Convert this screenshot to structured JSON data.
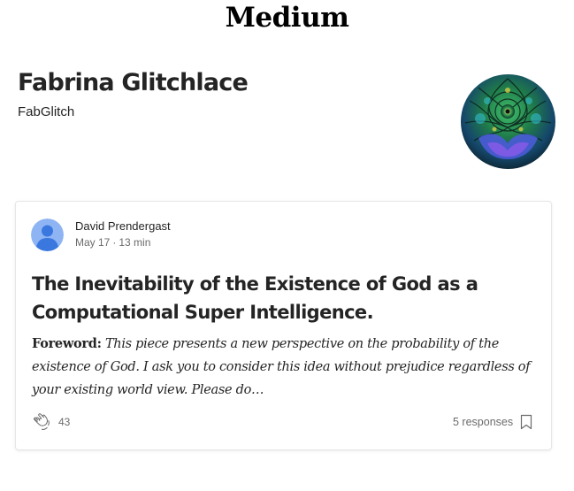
{
  "site": {
    "logo_text": "Medium"
  },
  "profile": {
    "name": "Fabrina Glitchlace",
    "handle": "FabGlitch",
    "avatar_icon": "psychedelic-art-avatar"
  },
  "post": {
    "author": "David Prendergast",
    "author_avatar_icon": "default-user-avatar",
    "date": "May 17",
    "separator": "·",
    "read_time": "13 min",
    "title": "The Inevitability of the Existence of God as a Computational Super Intelligence.",
    "excerpt_lead": "Foreword:",
    "excerpt_body": "This piece presents a new perspective on the probability of the existence of God. I ask you to consider this idea without prejudice regardless of your existing world view. Please do…",
    "claps": "43",
    "responses": "5 responses",
    "clap_icon": "clap-icon",
    "bookmark_icon": "bookmark-icon"
  },
  "colors": {
    "text": "#242424",
    "muted": "#6b6b6b",
    "card_border": "#e6e6e6",
    "avatar_blue": "#6ba1f0"
  }
}
